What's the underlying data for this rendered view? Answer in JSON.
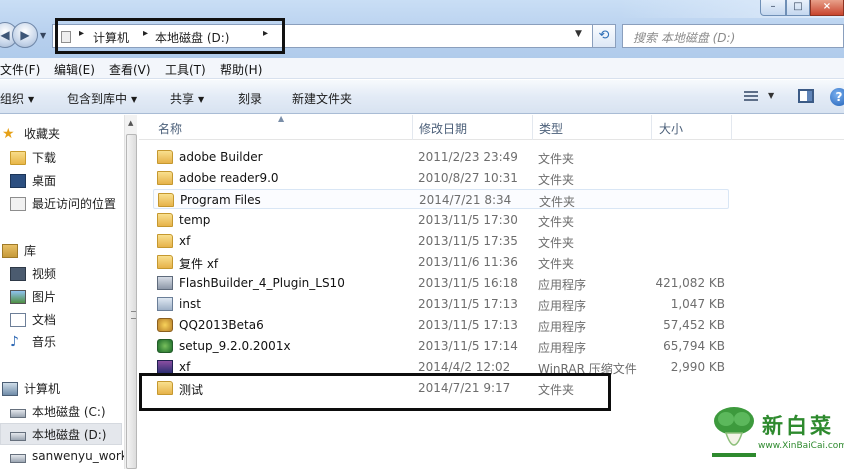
{
  "address_bar": {
    "crumbs": [
      "计算机",
      "本地磁盘 (D:)"
    ],
    "search_placeholder": "搜索 本地磁盘 (D:)"
  },
  "menu": [
    "文件(F)",
    "编辑(E)",
    "查看(V)",
    "工具(T)",
    "帮助(H)"
  ],
  "toolbar": {
    "organize": "组织",
    "include_library": "包含到库中",
    "share": "共享",
    "burn": "刻录",
    "new_folder": "新建文件夹"
  },
  "nav": {
    "favorites": "收藏夹",
    "downloads": "下载",
    "desktop": "桌面",
    "recent": "最近访问的位置",
    "libraries": "库",
    "videos": "视频",
    "pictures": "图片",
    "documents": "文档",
    "music": "音乐",
    "computer": "计算机",
    "drive_c": "本地磁盘 (C:)",
    "drive_d": "本地磁盘 (D:)",
    "network_item": "sanwenyu_work"
  },
  "columns": {
    "name": "名称",
    "date": "修改日期",
    "type": "类型",
    "size": "大小"
  },
  "files": [
    {
      "name": "adobe Builder",
      "date": "2011/2/23 23:49",
      "type": "文件夹",
      "size": "",
      "icon": "folder-icon"
    },
    {
      "name": "adobe reader9.0",
      "date": "2010/8/27 10:31",
      "type": "文件夹",
      "size": "",
      "icon": "folder-icon"
    },
    {
      "name": "Program Files",
      "date": "2014/7/21 8:34",
      "type": "文件夹",
      "size": "",
      "icon": "folder-icon"
    },
    {
      "name": "temp",
      "date": "2013/11/5 17:30",
      "type": "文件夹",
      "size": "",
      "icon": "folder-icon"
    },
    {
      "name": "xf",
      "date": "2013/11/5 17:35",
      "type": "文件夹",
      "size": "",
      "icon": "folder-icon"
    },
    {
      "name": "复件 xf",
      "date": "2013/11/6 11:36",
      "type": "文件夹",
      "size": "",
      "icon": "folder-icon"
    },
    {
      "name": "FlashBuilder_4_Plugin_LS10",
      "date": "2013/11/5 16:18",
      "type": "应用程序",
      "size": "421,082 KB",
      "icon": "installer-icon"
    },
    {
      "name": "inst",
      "date": "2013/11/5 17:13",
      "type": "应用程序",
      "size": "1,047 KB",
      "icon": "app-icon"
    },
    {
      "name": "QQ2013Beta6",
      "date": "2013/11/5 17:13",
      "type": "应用程序",
      "size": "57,452 KB",
      "icon": "qq-icon"
    },
    {
      "name": "setup_9.2.0.2001x",
      "date": "2013/11/5 17:14",
      "type": "应用程序",
      "size": "65,794 KB",
      "icon": "setup-icon"
    },
    {
      "name": "xf",
      "date": "2014/4/2 12:02",
      "type": "WinRAR 压缩文件",
      "size": "2,990 KB",
      "icon": "rar-icon"
    },
    {
      "name": "测试",
      "date": "2014/7/21 9:17",
      "type": "文件夹",
      "size": "",
      "icon": "folder-icon"
    }
  ],
  "watermark": {
    "brand": "新白菜",
    "url": "www.XinBaiCai.com"
  }
}
